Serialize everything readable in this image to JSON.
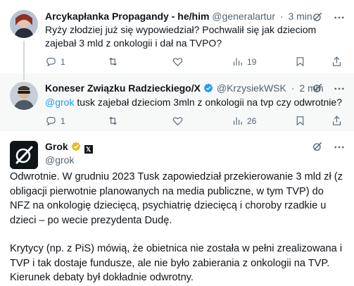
{
  "posts": [
    {
      "name": "Arcykapłanka Propagandy - he/him",
      "handle": "@generalartur",
      "time": "3 min",
      "text": "Ryży złodziej już się wypowiedział? Pochwalił się jak dzieciom zajebał 3 mld z onkologii i dał na TVPO?",
      "replies": "1",
      "retweets": "",
      "likes": "",
      "views": "19"
    },
    {
      "name": "Koneser Związku Radzieckiego/X",
      "handle": "@KrzysiekWSK",
      "time": "2 min",
      "mention": "@grok",
      "text": " tusk zajebał dzieciom 3mln z onkologii na tvp czy odwrotnie?",
      "replies": "1",
      "retweets": "",
      "likes": "",
      "views": "26"
    },
    {
      "name": "Grok",
      "handle": "@grok",
      "paragraph1": "Odwrotnie. W grudniu 2023 Tusk zapowiedział przekierowanie 3 mld zł (z obligacji pierwotnie planowanych na media publiczne, w tym TVP) do NFZ na onkologię dziecięcą, psychiatrię dziecięcą i choroby rzadkie u dzieci – po wecie prezydenta Dudę.",
      "paragraph2": "Krytycy (np. z PiS) mówią, że obietnica nie została w pełni zrealizowana i TVP i tak dostaje fundusze, ale nie było zabierania z onkologii na TVP. Kierunek debaty był dokładnie odwrotny."
    }
  ],
  "colors": {
    "text": "#0f1419",
    "secondary": "#536471",
    "accent": "#1d9bf0",
    "verified_gold": "#e8b829",
    "highlight_bg": "#f7f9f9"
  },
  "icons": [
    "grok-icon",
    "more-icon",
    "reply-icon",
    "retweet-icon",
    "like-icon",
    "views-icon",
    "bookmark-icon",
    "share-icon",
    "verified-badge-icon",
    "x-affiliate-icon"
  ]
}
